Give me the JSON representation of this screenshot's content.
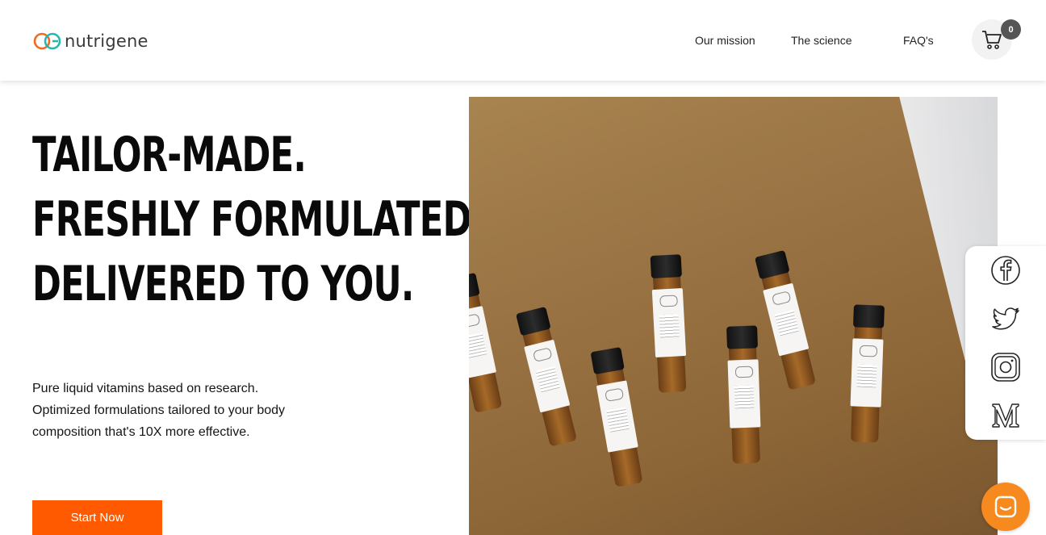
{
  "header": {
    "logo_text": "nutrigene",
    "nav": [
      {
        "label": "Our mission"
      },
      {
        "label": "The science"
      },
      {
        "label": "FAQ's"
      }
    ],
    "cart_count": "0",
    "cart_icon": "cart-icon"
  },
  "hero": {
    "headline": [
      "TAILOR-MADE.",
      "FRESHLY FORMULATED.",
      "DELIVERED TO YOU."
    ],
    "subtext": "Pure liquid vitamins based on research. Optimized formulations tailored to your body composition that's 10X more effective.",
    "cta_label": "Start Now"
  },
  "social": [
    "facebook-icon",
    "twitter-icon",
    "instagram-icon",
    "medium-icon"
  ],
  "chat_icon": "chat-icon",
  "colors": {
    "accent": "#ff5a00",
    "chat": "#f68a1f",
    "logo_orange": "#f26a21",
    "logo_teal": "#23b8b0"
  }
}
